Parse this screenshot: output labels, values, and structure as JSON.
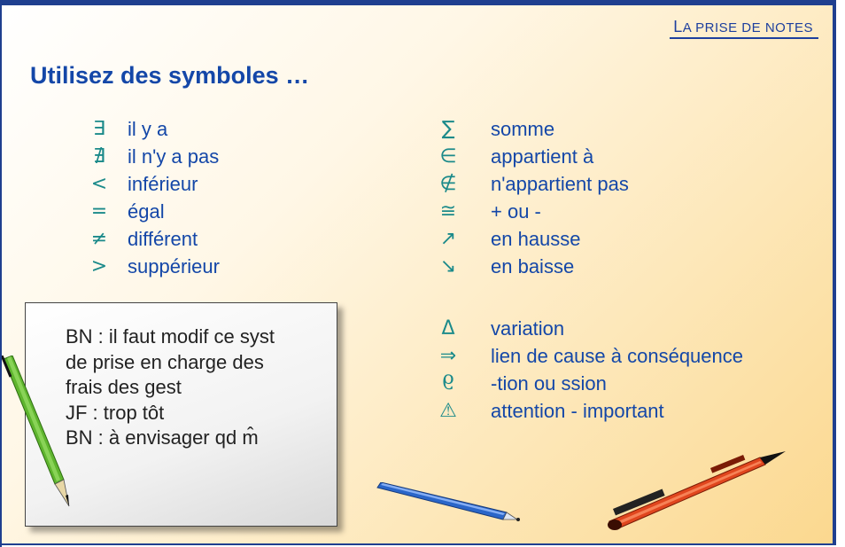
{
  "header": {
    "first_letter": "L",
    "rest": "A PRISE DE NOTES"
  },
  "title": "Utilisez des symboles …",
  "left_list": [
    {
      "icon": "exists-icon",
      "symbol": "∃",
      "label": "il y a"
    },
    {
      "icon": "not-exists-icon",
      "symbol": "∄",
      "label": "il n'y a pas"
    },
    {
      "icon": "less-than-icon",
      "symbol": "<",
      "label": "inférieur"
    },
    {
      "icon": "equals-icon",
      "symbol": "=",
      "label": "égal"
    },
    {
      "icon": "not-equal-icon",
      "symbol": "≠",
      "label": "différent"
    },
    {
      "icon": "greater-than-icon",
      "symbol": ">",
      "label": "suppérieur"
    }
  ],
  "right_list_top": [
    {
      "icon": "sum-icon",
      "symbol": "∑",
      "label": "somme"
    },
    {
      "icon": "element-of-icon",
      "symbol": "∈",
      "label": "appartient à"
    },
    {
      "icon": "not-element-of-icon",
      "symbol": "∉",
      "label": "n'appartient pas"
    },
    {
      "icon": "approx-equal-icon",
      "symbol": "≅",
      "label": "+ ou -"
    },
    {
      "icon": "arrow-up-right-icon",
      "symbol": "↗",
      "label": "en hausse"
    },
    {
      "icon": "arrow-down-right-icon",
      "symbol": "↘",
      "label": "en baisse"
    }
  ],
  "right_list_bottom": [
    {
      "icon": "delta-icon",
      "symbol": "Δ",
      "label": "variation"
    },
    {
      "icon": "implies-arrow-icon",
      "symbol": "⇒",
      "label": "lien de cause à conséquence"
    },
    {
      "icon": "tion-abbrev-icon",
      "symbol": "9",
      "label": "-tion ou ssion"
    },
    {
      "icon": "warning-triangle-icon",
      "symbol": "⚠",
      "label": "attention - important"
    }
  ],
  "note": {
    "lines": [
      "BN : il faut modif ce syst",
      "de prise en charge des",
      "frais des gest",
      "JF : trop tôt",
      "BN : à envisager qd m̂"
    ]
  },
  "colors": {
    "title": "#1447a8",
    "symbol": "#1b8a8a",
    "frame": "#1f3f8f"
  }
}
